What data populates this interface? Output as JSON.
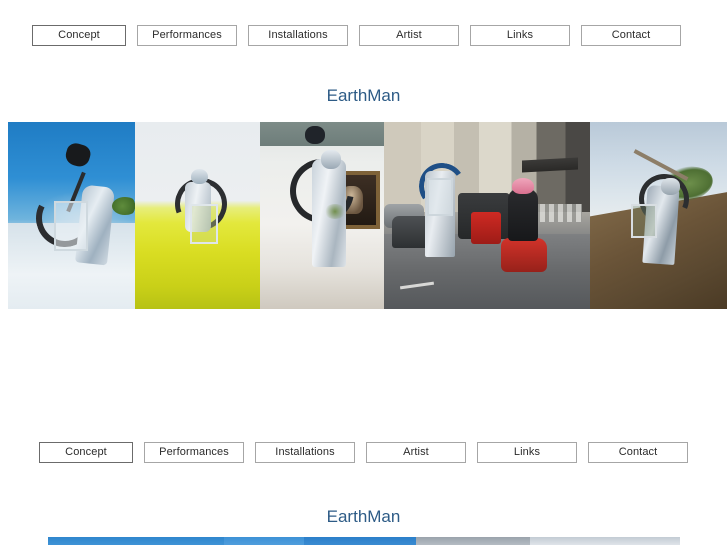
{
  "page": {
    "background_color": "#ffffff",
    "title_color": "#2d5b86"
  },
  "nav_top": {
    "name": "primary-navigation",
    "items": [
      {
        "label": "Concept",
        "active": true
      },
      {
        "label": "Performances",
        "active": false
      },
      {
        "label": "Installations",
        "active": false
      },
      {
        "label": "Artist",
        "active": false
      },
      {
        "label": "Links",
        "active": false
      },
      {
        "label": "Contact",
        "active": false
      }
    ]
  },
  "nav_bottom": {
    "name": "secondary-navigation",
    "items": [
      {
        "label": "Concept",
        "active": true
      },
      {
        "label": "Performances",
        "active": false
      },
      {
        "label": "Installations",
        "active": false
      },
      {
        "label": "Artist",
        "active": false
      },
      {
        "label": "Links",
        "active": false
      },
      {
        "label": "Contact",
        "active": false
      }
    ]
  },
  "headings": {
    "top": "EarthMan",
    "bottom": "EarthMan"
  },
  "gallery_top": {
    "name": "image-strip-top",
    "images": [
      {
        "alt": "Silver-suited figure with shovel and backpack terrarium on snowy plain under blue sky"
      },
      {
        "alt": "Silver-suited figure with backpack terrarium standing in a yellow rapeseed field"
      },
      {
        "alt": "Silver-suited figure with coiled hose standing in a museum gallery beside a framed painting"
      },
      {
        "alt": "Silver-suited figure on a wheeled platform in Paris street traffic beside a scooter rider in a pink helmet"
      },
      {
        "alt": "Silver-suited figure carrying a tree on a pole up a bare earth mound"
      }
    ]
  },
  "gallery_bottom": {
    "name": "image-strip-bottom",
    "images": [
      {
        "alt": "Top sliver of blue sky photograph"
      },
      {
        "alt": "Top sliver of blue sky photograph"
      },
      {
        "alt": "Top sliver of blue sky photograph"
      },
      {
        "alt": "Top sliver of grey sky photograph"
      },
      {
        "alt": "Top sliver of pale sky photograph"
      }
    ]
  }
}
